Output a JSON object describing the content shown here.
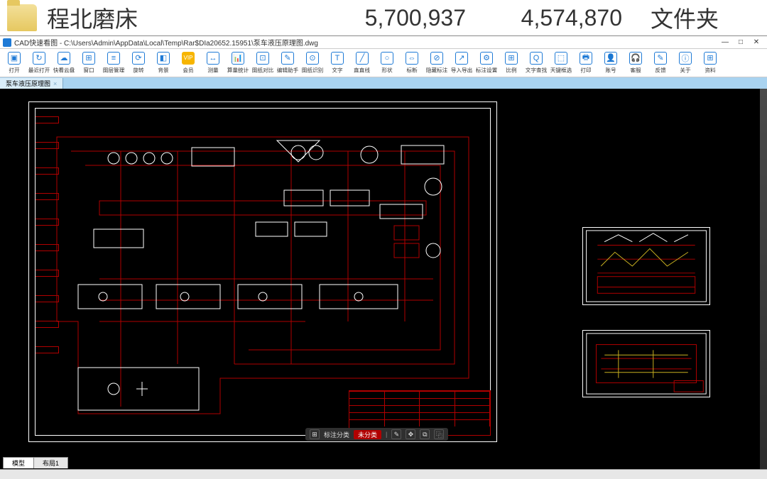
{
  "file_row": {
    "name": "程北磨床",
    "size1": "5,700,937",
    "size2": "4,574,870",
    "type": "文件夹"
  },
  "window": {
    "app": "CAD快速看图",
    "path": "C:\\Users\\Admin\\AppData\\Local\\Temp\\Rar$DIa20652.15951\\泵车液压原理图.dwg",
    "min": "—",
    "max": "□",
    "close": "✕"
  },
  "toolbar": [
    {
      "icon": "▣",
      "label": "打开"
    },
    {
      "icon": "↻",
      "label": "最近打开"
    },
    {
      "icon": "☁",
      "label": "快看云盘"
    },
    {
      "icon": "⊞",
      "label": "窗口"
    },
    {
      "icon": "≡",
      "label": "图层管理"
    },
    {
      "icon": "⟳",
      "label": "旋转"
    },
    {
      "icon": "◧",
      "label": "背景"
    },
    {
      "icon": "VIP",
      "label": "会员",
      "vip": true
    },
    {
      "icon": "↔",
      "label": "测量"
    },
    {
      "icon": "📊",
      "label": "算量统计"
    },
    {
      "icon": "⊡",
      "label": "图纸对比"
    },
    {
      "icon": "✎",
      "label": "编辑助手"
    },
    {
      "icon": "⊙",
      "label": "图纸识别"
    },
    {
      "icon": "T",
      "label": "文字"
    },
    {
      "icon": "╱",
      "label": "直直线"
    },
    {
      "icon": "○",
      "label": "形状"
    },
    {
      "icon": "⇔",
      "label": "标断"
    },
    {
      "icon": "⊘",
      "label": "隐藏标注"
    },
    {
      "icon": "↗",
      "label": "导入导出"
    },
    {
      "icon": "⚙",
      "label": "标注设置"
    },
    {
      "icon": "⊞",
      "label": "比例"
    },
    {
      "icon": "Q",
      "label": "文字查找"
    },
    {
      "icon": "⬚",
      "label": "天键框选"
    },
    {
      "icon": "🖶",
      "label": "打印"
    },
    {
      "icon": "👤",
      "label": "账号"
    },
    {
      "icon": "🎧",
      "label": "客服"
    },
    {
      "icon": "✎",
      "label": "反馈"
    },
    {
      "icon": "ⓘ",
      "label": "关于"
    },
    {
      "icon": "⊞",
      "label": "资料"
    }
  ],
  "doc_tab": {
    "name": "泵车液压原理图",
    "close": "×"
  },
  "view_strip": {
    "grid": "⊞",
    "label": "标注分类",
    "value": "未分类",
    "edit": "✎",
    "move": "✥",
    "copy": "⧉",
    "dup": "⿻"
  },
  "layout_tabs": {
    "model": "模型",
    "layout1": "布局1"
  }
}
